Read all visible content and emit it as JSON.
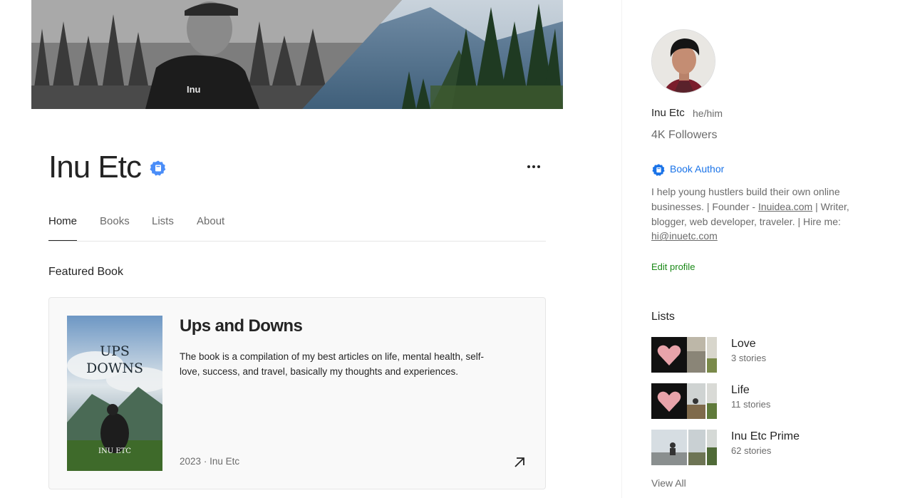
{
  "profile": {
    "name": "Inu Etc",
    "pronouns": "he/him",
    "followers": "4K Followers",
    "badge_label": "Book Author",
    "bio_parts": [
      "I help young hustlers build their own online businesses. | Founder - ",
      "Inuidea.com",
      " | Writer, blogger, web developer, traveler. | Hire me: ",
      "hi@inuetc.com"
    ],
    "edit_label": "Edit profile"
  },
  "tabs": [
    {
      "label": "Home",
      "active": true
    },
    {
      "label": "Books",
      "active": false
    },
    {
      "label": "Lists",
      "active": false
    },
    {
      "label": "About",
      "active": false
    }
  ],
  "featured": {
    "section_title": "Featured Book",
    "book_title": "Ups and Downs",
    "description": "The book is a compilation of my best articles on life, mental health, self-love, success, and travel, basically my thoughts and experiences.",
    "year": "2023",
    "separator": "·",
    "author": "Inu Etc",
    "cover_title_line1": "UPS",
    "cover_title_line2": "DOWNS",
    "cover_author": "INU ETC"
  },
  "lists": {
    "title": "Lists",
    "items": [
      {
        "name": "Love",
        "count": "3 stories"
      },
      {
        "name": "Life",
        "count": "11 stories"
      },
      {
        "name": "Inu Etc Prime",
        "count": "62 stories"
      }
    ],
    "view_all_label": "View All"
  },
  "colors": {
    "accent_blue": "#1a73e8",
    "accent_green": "#1a8917",
    "text_primary": "#242424",
    "text_secondary": "#6b6b6b"
  }
}
